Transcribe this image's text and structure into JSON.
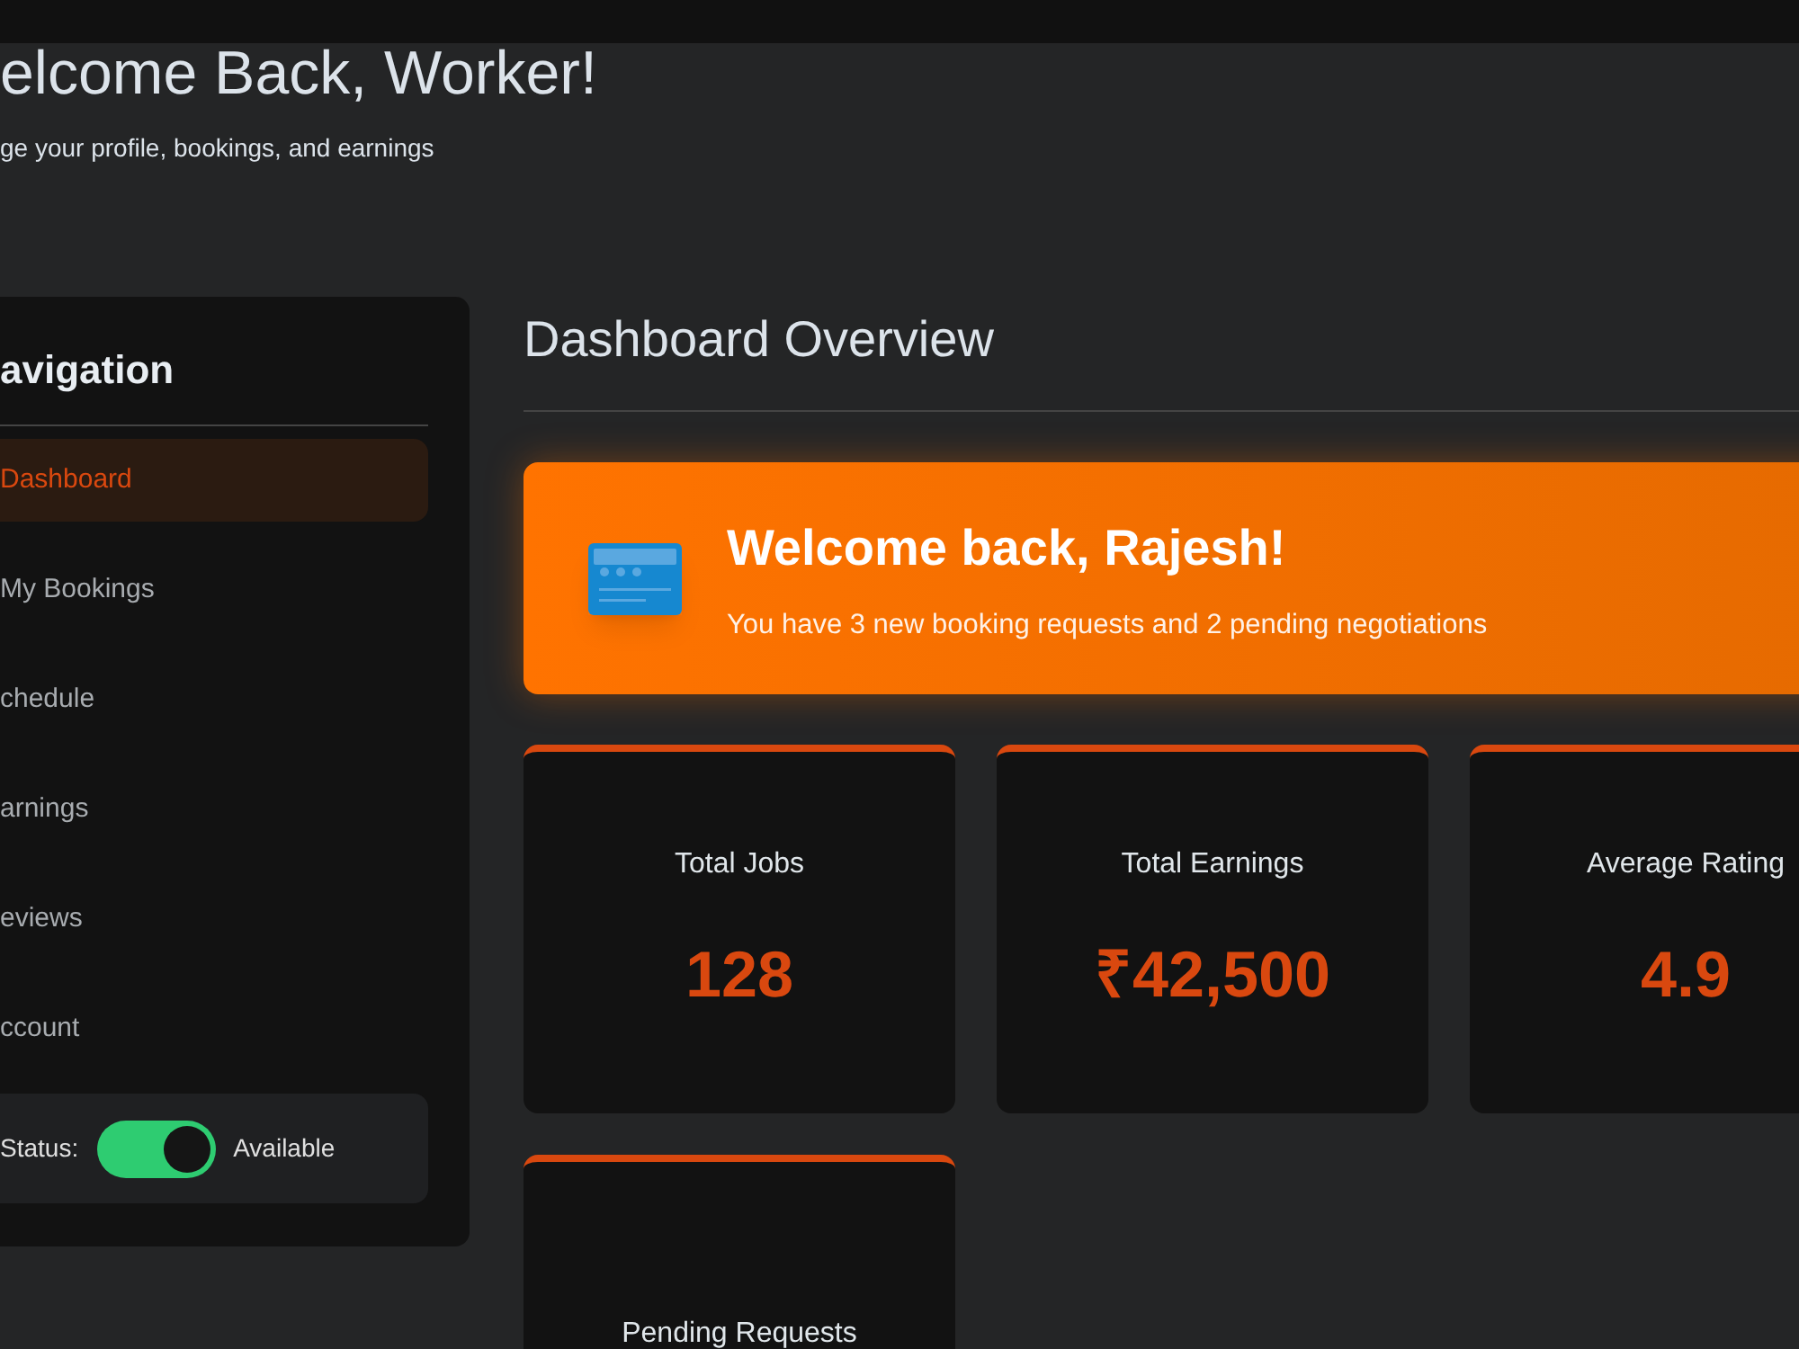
{
  "header": {
    "title": "elcome Back, Worker!",
    "subtitle": "ge your profile, bookings, and earnings"
  },
  "sidebar": {
    "title": "avigation",
    "items": [
      {
        "label": "Dashboard",
        "selected": true
      },
      {
        "label": "My Bookings",
        "selected": false
      },
      {
        "label": "chedule",
        "selected": false
      },
      {
        "label": "arnings",
        "selected": false
      },
      {
        "label": "eviews",
        "selected": false
      },
      {
        "label": "ccount",
        "selected": false
      }
    ],
    "status": {
      "label": "Status:",
      "on": true,
      "text": "Available"
    }
  },
  "main": {
    "title": "Dashboard Overview",
    "banner": {
      "title": "Welcome back, Rajesh!",
      "message": "You have 3 new booking requests and 2 pending negotiations"
    },
    "stats": [
      {
        "label": "Total Jobs",
        "value": "128"
      },
      {
        "label": "Total Earnings",
        "value": "₹42,500"
      },
      {
        "label": "Average Rating",
        "value": "4.9"
      },
      {
        "label": "Pending Requests"
      }
    ]
  }
}
